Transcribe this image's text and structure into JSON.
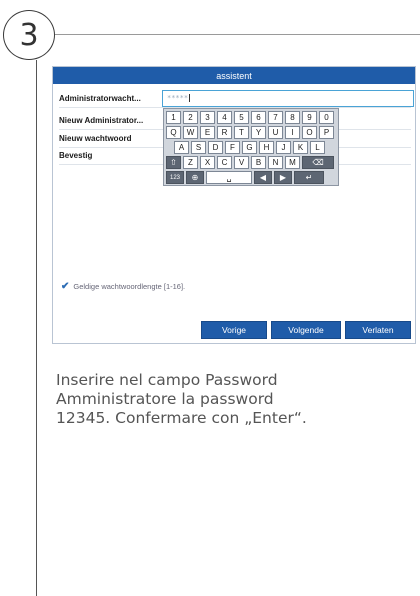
{
  "step": {
    "number": "3"
  },
  "window": {
    "title": "assistent",
    "rows": [
      {
        "label": "Administratorwacht..."
      },
      {
        "label": "Nieuw Administrator..."
      },
      {
        "label": "Nieuw wachtwoord"
      },
      {
        "label": "Bevestig"
      }
    ],
    "password_value": "*****",
    "keyboard": {
      "row1": [
        "1",
        "2",
        "3",
        "4",
        "5",
        "6",
        "7",
        "8",
        "9",
        "0"
      ],
      "row2": [
        "Q",
        "W",
        "E",
        "R",
        "T",
        "Y",
        "U",
        "I",
        "O",
        "P"
      ],
      "row3": [
        "A",
        "S",
        "D",
        "F",
        "G",
        "H",
        "J",
        "K",
        "L"
      ],
      "row4": [
        "Z",
        "X",
        "C",
        "V",
        "B",
        "N",
        "M"
      ],
      "row5_label": "123"
    },
    "hint": "Geldige wachtwoordlengte [1-16].",
    "buttons": {
      "prev": "Vorige",
      "next": "Volgende",
      "exit": "Verlaten"
    }
  },
  "caption": {
    "line1": "Inserire nel campo Password",
    "line2": "Amministratore la password",
    "line3": "12345. Confermare con „Enter“."
  },
  "colors": {
    "title_bar": "#1f5ca9",
    "input_border": "#4aa3d6"
  }
}
